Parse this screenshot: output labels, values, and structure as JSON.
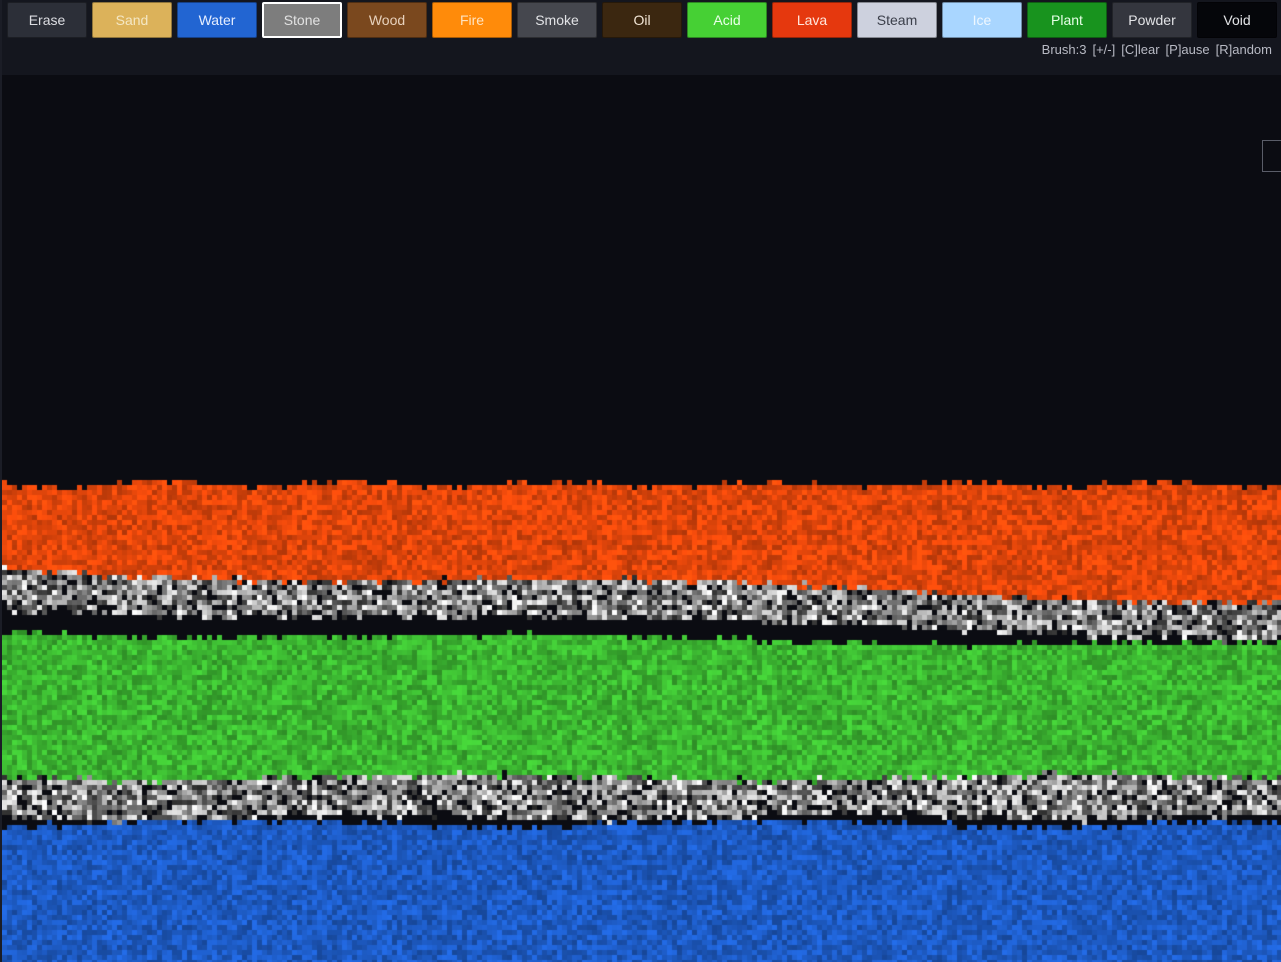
{
  "toolbar": {
    "materials": [
      {
        "label": "Erase",
        "color": "#2c2f38",
        "text_color": "#dcdde2",
        "selected": false
      },
      {
        "label": "Sand",
        "color": "#dcb25a",
        "text_color": "#f4e7c4",
        "selected": false
      },
      {
        "label": "Water",
        "color": "#2265d2",
        "text_color": "#e6eeff",
        "selected": false
      },
      {
        "label": "Stone",
        "color": "#7d7d7d",
        "text_color": "#e2e2e2",
        "selected": true
      },
      {
        "label": "Wood",
        "color": "#7a481e",
        "text_color": "#e8d2bd",
        "selected": false
      },
      {
        "label": "Fire",
        "color": "#ff8b0a",
        "text_color": "#ffe3c0",
        "selected": false
      },
      {
        "label": "Smoke",
        "color": "#45474e",
        "text_color": "#e2e3e6",
        "selected": false
      },
      {
        "label": "Oil",
        "color": "#3b2710",
        "text_color": "#f2e6d6",
        "selected": false
      },
      {
        "label": "Acid",
        "color": "#46d034",
        "text_color": "#eaffea",
        "selected": false
      },
      {
        "label": "Lava",
        "color": "#e5380e",
        "text_color": "#ffe6dc",
        "selected": false
      },
      {
        "label": "Steam",
        "color": "#cdd1de",
        "text_color": "#3b3f4a",
        "selected": false
      },
      {
        "label": "Ice",
        "color": "#a9d6ff",
        "text_color": "#eef7ff",
        "selected": false
      },
      {
        "label": "Plant",
        "color": "#18931e",
        "text_color": "#e6ffe6",
        "selected": false
      },
      {
        "label": "Powder",
        "color": "#34363e",
        "text_color": "#e2e3e6",
        "selected": false
      },
      {
        "label": "Void",
        "color": "#05060a",
        "text_color": "#e2e3e6",
        "selected": false
      }
    ],
    "hints": {
      "brush": "Brush:3",
      "resize": "[+/-]",
      "clear": "[C]lear",
      "pause": "[P]ause",
      "random": "[R]andom"
    }
  },
  "simulation": {
    "background": "#0b0c12",
    "layers": [
      {
        "material": "Lava",
        "base_color": "#ee4a0c"
      },
      {
        "material": "Stone",
        "base_color": "#9a9a9a"
      },
      {
        "material": "Acid",
        "base_color": "#3fbf34"
      },
      {
        "material": "Stone",
        "base_color": "#9a9a9a"
      },
      {
        "material": "Water",
        "base_color": "#1f5fcc"
      }
    ]
  }
}
